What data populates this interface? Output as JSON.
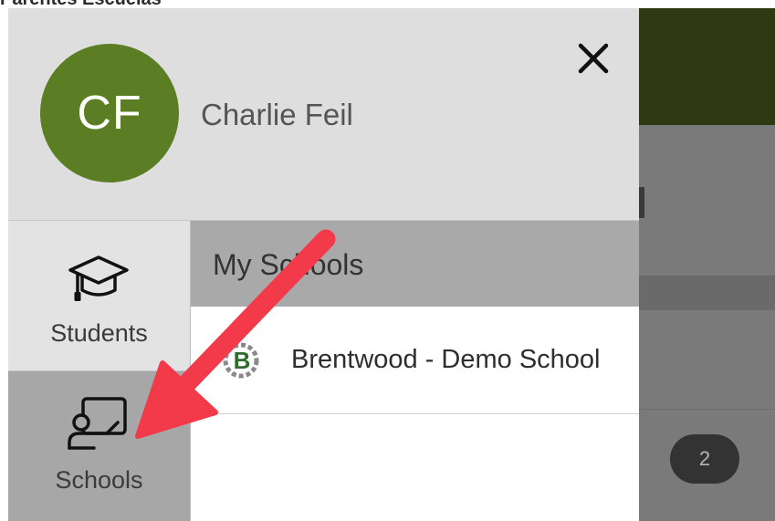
{
  "caption": "Parentes Escuelas",
  "background": {
    "badge_count": "2"
  },
  "drawer": {
    "user": {
      "initials": "CF",
      "name": "Charlie Feil",
      "avatar_color": "#5b7d24"
    },
    "close_icon": "close-icon",
    "nav": [
      {
        "label": "Students",
        "icon": "graduation-cap-icon",
        "selected": false
      },
      {
        "label": "Schools",
        "icon": "teacher-board-icon",
        "selected": true
      }
    ],
    "section_title": "My Schools",
    "schools": [
      {
        "name": "Brentwood - Demo School",
        "logo_letter": "B",
        "logo_icon": "school-gear-logo-icon"
      }
    ]
  },
  "annotation": {
    "arrow_color": "#f23a4b"
  }
}
